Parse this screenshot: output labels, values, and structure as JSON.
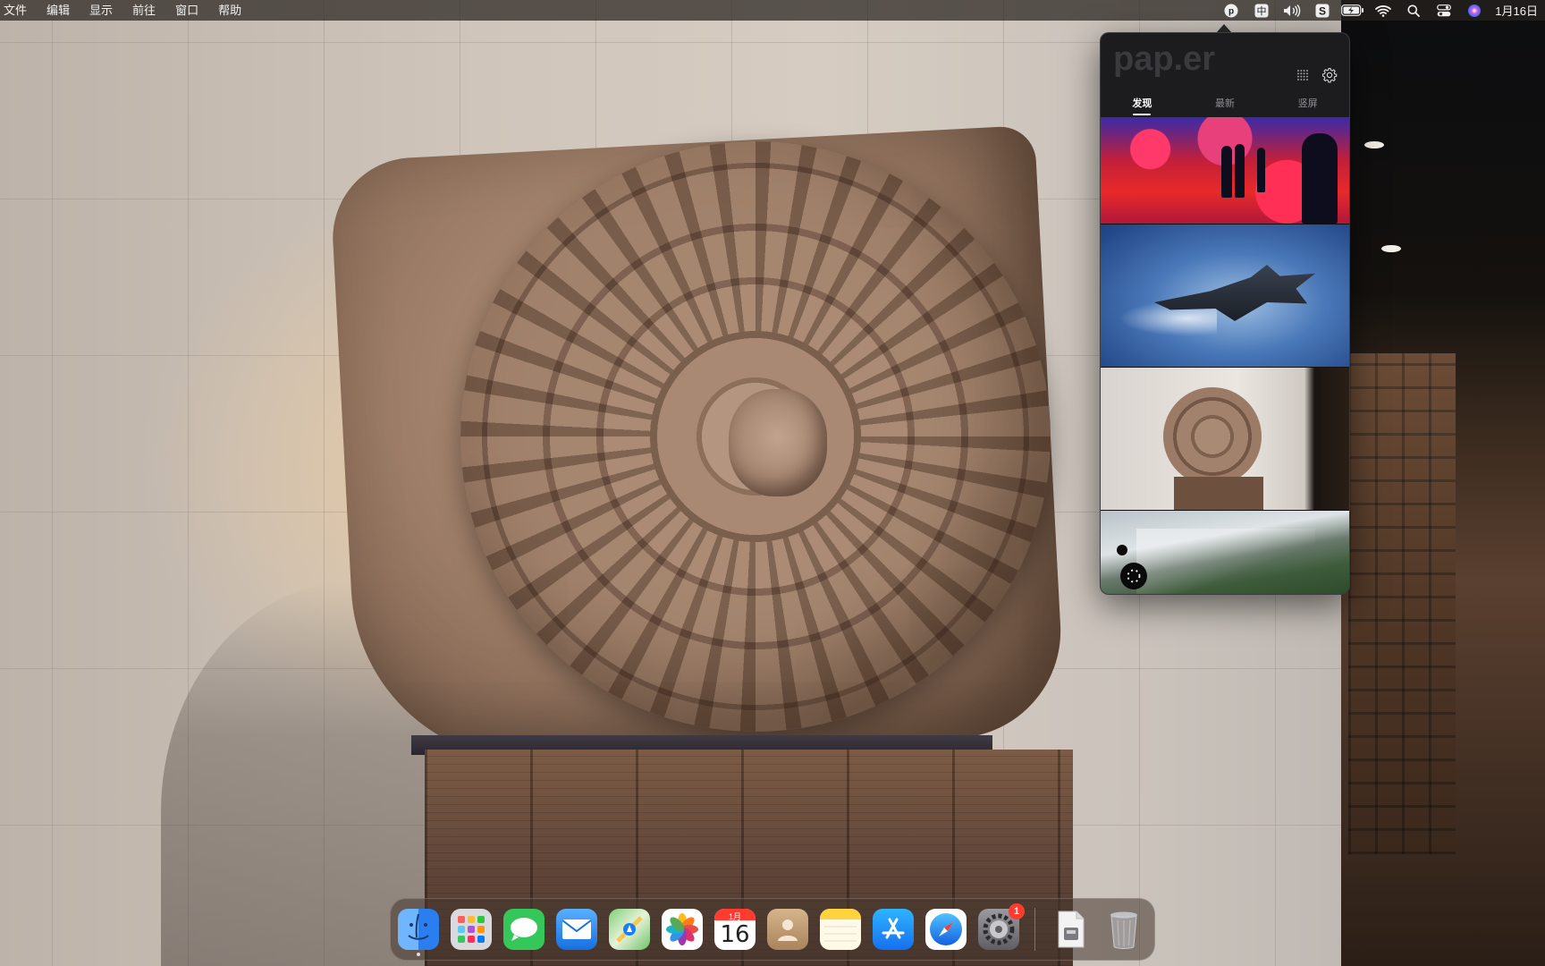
{
  "menubar": {
    "items": [
      "文件",
      "编辑",
      "显示",
      "前往",
      "窗口",
      "帮助"
    ],
    "tray": {
      "paper_icon": "paper-p-icon",
      "input_method": "中",
      "volume_icon": "volume-icon",
      "s_app_icon": "s-app-icon",
      "battery_icon": "battery-charging-icon",
      "wifi_icon": "wifi-icon",
      "search_icon": "spotlight-search-icon",
      "control_center_icon": "control-center-icon",
      "siri_icon": "siri-icon",
      "date": "1月16日"
    }
  },
  "popover": {
    "logo": "pap.er",
    "tabs": [
      {
        "label": "发现",
        "active": true
      },
      {
        "label": "最新",
        "active": false
      },
      {
        "label": "竖屏",
        "active": false
      }
    ],
    "thumbnails": [
      {
        "subject": "red-gallery-silhouettes"
      },
      {
        "subject": "stealth-jet"
      },
      {
        "subject": "sun-stone"
      },
      {
        "subject": "mountain-valley"
      }
    ]
  },
  "dock": {
    "apps": [
      {
        "name": "Finder",
        "color": "#3e8ef7"
      },
      {
        "name": "Launchpad",
        "color": "#d9d9de"
      },
      {
        "name": "Messages",
        "color": "#35c759"
      },
      {
        "name": "Mail",
        "color": "#2d8cf0"
      },
      {
        "name": "Maps",
        "color": "#6cc46a"
      },
      {
        "name": "Photos",
        "color": "#ffffff"
      },
      {
        "name": "Calendar",
        "color": "#ffffff",
        "month": "1月",
        "day": "16"
      },
      {
        "name": "Contacts",
        "color": "#c8a27a"
      },
      {
        "name": "Notes",
        "color": "#fff9e6"
      },
      {
        "name": "App Store",
        "color": "#1d8cf8"
      },
      {
        "name": "Safari",
        "color": "#1a8cff"
      },
      {
        "name": "System Settings",
        "color": "#8e8e93",
        "badge": "1"
      }
    ],
    "utilities": [
      {
        "name": "Disk Utility"
      },
      {
        "name": "Trash"
      }
    ]
  }
}
